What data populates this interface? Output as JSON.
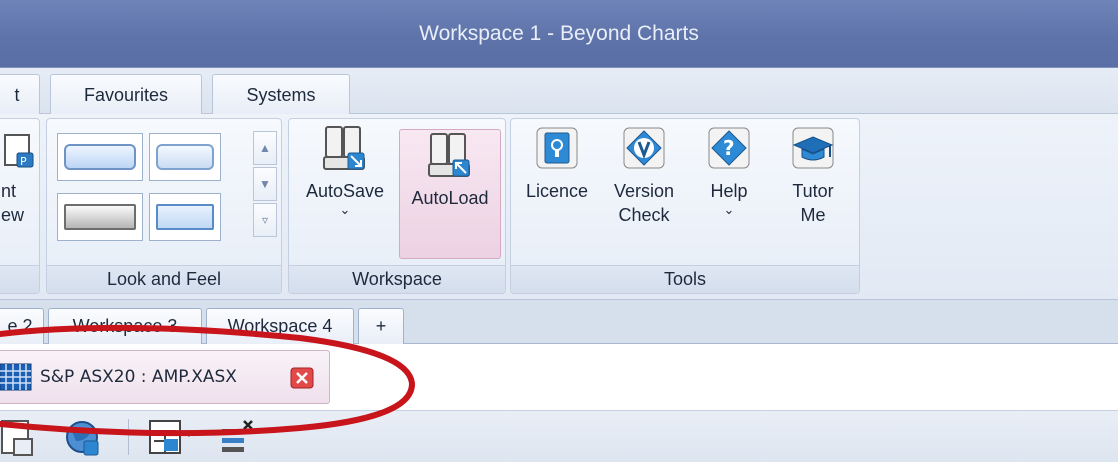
{
  "window": {
    "title": "Workspace 1 - Beyond Charts"
  },
  "ribbon_tabs": [
    {
      "label": "t"
    },
    {
      "label": "Favourites"
    },
    {
      "label": "Systems"
    }
  ],
  "groups": {
    "partial": {
      "label_line1": "nt",
      "label_line2": "ew",
      "icon": "print-preview-icon"
    },
    "look_and_feel": {
      "label": "Look and Feel"
    },
    "workspace": {
      "label": "Workspace",
      "autosave": {
        "label": "AutoSave",
        "arrow": "⌄",
        "icon": "autosave-icon"
      },
      "autoload": {
        "label": "AutoLoad",
        "icon": "autoload-icon"
      }
    },
    "tools": {
      "label": "Tools",
      "licence": {
        "label": "Licence",
        "icon": "licence-icon"
      },
      "version": {
        "label_line1": "Version",
        "label_line2": "Check",
        "icon": "version-check-icon"
      },
      "help": {
        "label": "Help",
        "arrow": "⌄",
        "icon": "help-icon"
      },
      "tutor": {
        "label_line1": "Tutor",
        "label_line2": "Me",
        "icon": "graduation-cap-icon"
      }
    }
  },
  "workspace_tabs": [
    {
      "label": "e 2"
    },
    {
      "label": "Workspace 3"
    },
    {
      "label": "Workspace 4"
    },
    {
      "label": "+"
    }
  ],
  "chart_tab": {
    "label": "S&P ASX20 : AMP.XASX",
    "icon": "grid-icon",
    "close_icon": "close-icon"
  },
  "colors": {
    "title_bar": "#6a7fb5",
    "annotation": "#c8141b",
    "active_button": "#f0d9e8"
  }
}
